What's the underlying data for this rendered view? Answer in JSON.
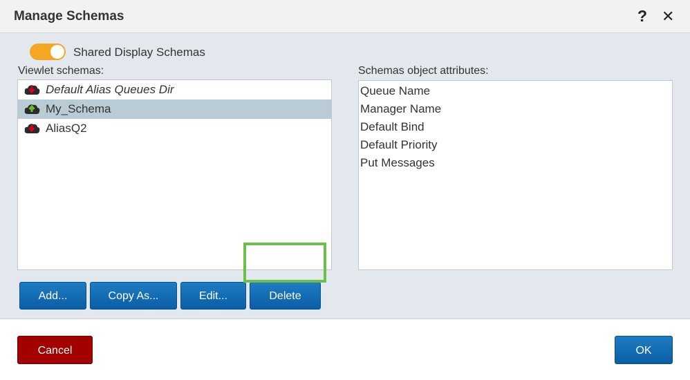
{
  "dialog": {
    "title": "Manage Schemas"
  },
  "icons": {
    "help": "question-mark-icon",
    "close": "close-icon",
    "schema_cloud": "cloud-icon"
  },
  "colors": {
    "toggle_on": "#f5a623",
    "primary_button": "#0a5ea6",
    "cancel_button": "#a30000",
    "selection": "#b9ccd6",
    "highlight_outline": "#6ac04a",
    "arrow_down": "#d9001b",
    "arrow_up": "#6abf2e"
  },
  "toggle": {
    "label": "Shared Display Schemas",
    "on": true
  },
  "viewlet_schemas": {
    "label": "Viewlet schemas:",
    "items": [
      {
        "label": "Default Alias Queues Dir",
        "italic": true,
        "selected": false,
        "arrow": "down"
      },
      {
        "label": "My_Schema",
        "italic": false,
        "selected": true,
        "arrow": "up"
      },
      {
        "label": "AliasQ2",
        "italic": false,
        "selected": false,
        "arrow": "down"
      }
    ]
  },
  "attributes": {
    "label": "Schemas object attributes:",
    "items": [
      "Queue Name",
      "Manager Name",
      "Default Bind",
      "Default Priority",
      "Put Messages"
    ]
  },
  "actions": {
    "add": "Add...",
    "copy_as": "Copy As...",
    "edit": "Edit...",
    "delete": "Delete"
  },
  "footer": {
    "cancel": "Cancel",
    "ok": "OK"
  }
}
